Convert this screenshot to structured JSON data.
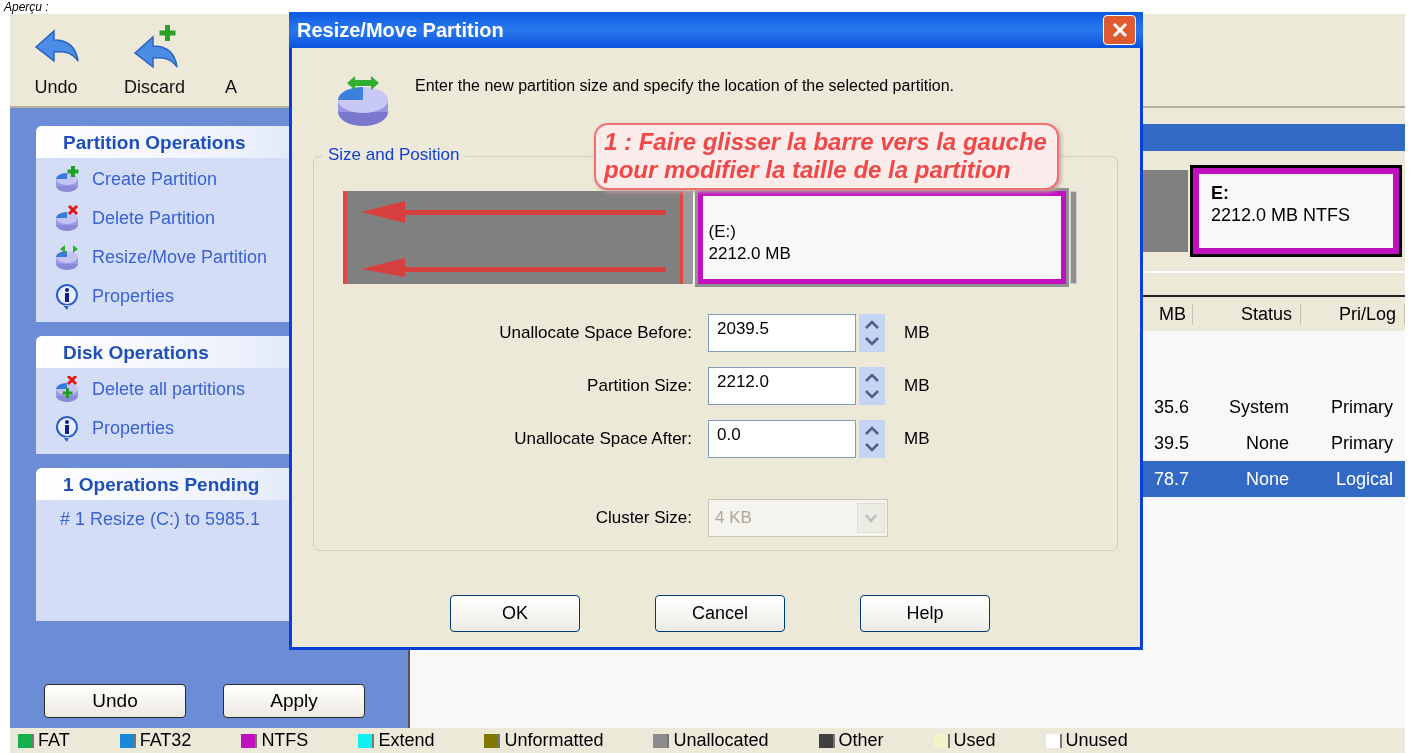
{
  "caption": "Aperçu :",
  "toolbar": [
    {
      "label": "Undo",
      "kind": "undo"
    },
    {
      "label": "Discard",
      "kind": "discard"
    },
    {
      "label": "A"
    }
  ],
  "sidebar": {
    "sections": [
      {
        "title": "Partition Operations",
        "items": [
          {
            "label": "Create Partition",
            "kind": "create"
          },
          {
            "label": "Delete Partition",
            "kind": "delete"
          },
          {
            "label": "Resize/Move Partition",
            "kind": "resize"
          },
          {
            "label": "Properties",
            "kind": "info"
          }
        ]
      },
      {
        "title": "Disk Operations",
        "items": [
          {
            "label": "Delete all partitions",
            "kind": "delete_all"
          },
          {
            "label": "Properties",
            "kind": "info"
          }
        ]
      },
      {
        "title": "1 Operations Pending",
        "items": [
          {
            "label": "#  1  Resize (C:) to 5985.1",
            "kind": "pending"
          }
        ]
      }
    ],
    "buttons": [
      "Undo",
      "Apply"
    ]
  },
  "disk_map": {
    "partitions": [
      {
        "kind": "unallocated",
        "selected": false
      },
      {
        "kind": "ntfs",
        "name": "E:",
        "info": "2212.0 MB  NTFS",
        "selected": true
      }
    ]
  },
  "partition_table": {
    "columns": [
      "MB",
      "Status",
      "Pri/Log"
    ],
    "rows": [
      {
        "cells": [
          "35.6",
          "System",
          "Primary"
        ],
        "selected": false
      },
      {
        "cells": [
          "39.5",
          "None",
          "Primary"
        ],
        "selected": false
      },
      {
        "cells": [
          "78.7",
          "None",
          "Logical"
        ],
        "selected": true
      }
    ]
  },
  "dialog": {
    "title": "Resize/Move Partition",
    "description": "Enter the new partition size and specify the location of the selected partition.",
    "group_label": "Size and Position",
    "partition_bar": {
      "name": "(E:)",
      "size": "2212.0 MB"
    },
    "fields": [
      {
        "label": "Unallocate Space Before:",
        "value": "2039.5",
        "unit": "MB",
        "kind": "spin",
        "disabled": false
      },
      {
        "label": "Partition Size:",
        "value": "2212.0",
        "unit": "MB",
        "kind": "spin",
        "disabled": false
      },
      {
        "label": "Unallocate Space After:",
        "value": "0.0",
        "unit": "MB",
        "kind": "spin",
        "disabled": false
      },
      {
        "label": "Cluster Size:",
        "value": "4 KB",
        "kind": "combo",
        "disabled": true
      }
    ],
    "buttons": [
      "OK",
      "Cancel",
      "Help"
    ]
  },
  "callout": {
    "text": "1 : Faire glisser la barre vers la gauche\npour modifier la taille de la partition"
  },
  "legend": [
    {
      "label": "FAT",
      "color": "#14b04a"
    },
    {
      "label": "FAT32",
      "color": "#1a88d8"
    },
    {
      "label": "NTFS",
      "color": "#c010c0"
    },
    {
      "label": "Extend",
      "color": "#10f0f0"
    },
    {
      "label": "Unformatted",
      "color": "#807800"
    },
    {
      "label": "Unallocated",
      "color": "#8c8c8c"
    },
    {
      "label": "Other",
      "color": "#404040"
    },
    {
      "label": "Used",
      "color": "#f4f2c8"
    },
    {
      "label": "Unused",
      "color": "#ffffff"
    }
  ]
}
